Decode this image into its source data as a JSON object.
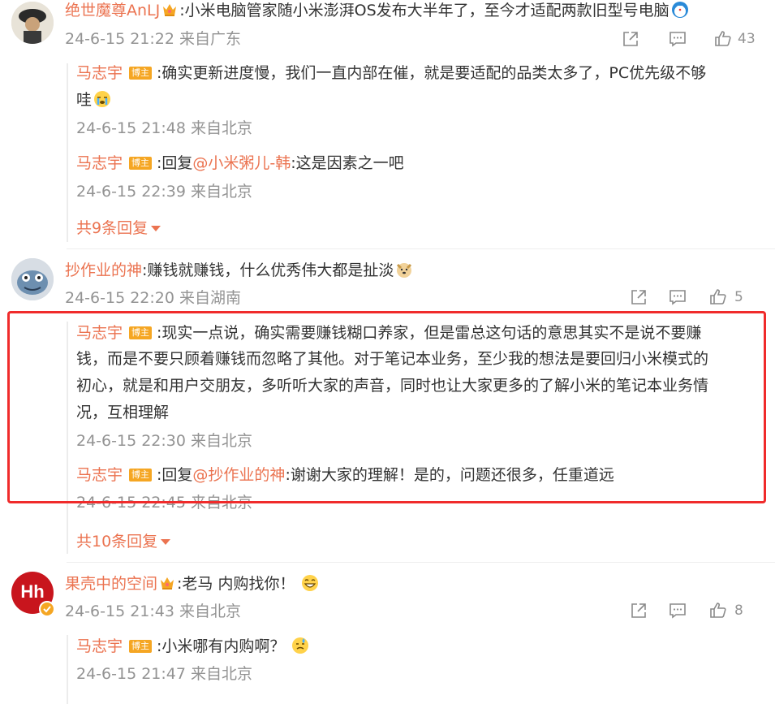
{
  "comments": [
    {
      "user": "绝世魔尊AnLJ",
      "text": ":小米电脑管家随小米澎湃OS发布大半年了，至今才适配两款旧型号电脑",
      "time": "24-6-15 21:22 来自广东",
      "likes": "43",
      "replies": [
        {
          "user": "马志宇",
          "badge": "博主",
          "text_1": ":确实更新进度慢，我们一直内部在催，就是要适配的品类太多了，PC优先级不够",
          "text_2": "哇",
          "time": "24-6-15 21:48 来自北京"
        },
        {
          "user": "马志宇",
          "badge": "博主",
          "prefix": ":回复",
          "mention": "@小米粥儿-韩",
          "text": ":这是因素之一吧",
          "time": "24-6-15 22:39 来自北京"
        }
      ],
      "more": "共9条回复"
    },
    {
      "user": "抄作业的神",
      "text": ":赚钱就赚钱，什么优秀伟大都是扯淡",
      "time": "24-6-15 22:20 来自湖南",
      "likes": "5",
      "replies": [
        {
          "user": "马志宇",
          "badge": "博主",
          "line_1": ":现实一点说，确实需要赚钱糊口养家，但是雷总这句话的意思其实不是说不要赚",
          "line_2": "钱，而是不要只顾着赚钱而忽略了其他。对于笔记本业务，至少我的想法是要回归小米模式的",
          "line_3": "初心，就是和用户交朋友，多听听大家的声音，同时也让大家更多的了解小米的笔记本业务情",
          "line_4": "况，互相理解",
          "time": "24-6-15 22:30 来自北京"
        },
        {
          "user": "马志宇",
          "badge": "博主",
          "prefix": ":回复",
          "mention": "@抄作业的神",
          "text": ":谢谢大家的理解！是的，问题还很多，任重道远",
          "time": "24-6-15 22:45 来自北京"
        }
      ],
      "more": "共10条回复"
    },
    {
      "user": "果壳中的空间",
      "avatar_text": "Hh",
      "text": ":老马 内购找你！",
      "time": "24-6-15 21:43 来自北京",
      "likes": "8",
      "replies": [
        {
          "user": "马志宇",
          "badge": "博主",
          "text": ":小米哪有内购啊？",
          "time": "24-6-15 21:47 来自北京"
        }
      ]
    }
  ],
  "colors": {
    "username": "#eb7350",
    "meta": "#939393",
    "highlight": "#f02b2b",
    "badge": "#f5a623"
  }
}
